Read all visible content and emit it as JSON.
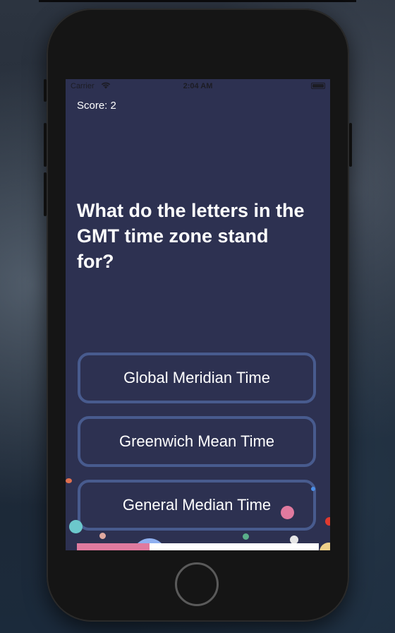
{
  "status_bar": {
    "carrier": "Carrier",
    "time": "2:04 AM"
  },
  "game": {
    "score_label": "Score: 2",
    "question": "What do the letters in the GMT time zone stand for?",
    "answers": [
      "Global Meridian Time",
      "Greenwich Mean Time",
      "General Median Time"
    ],
    "progress_fraction": 0.3
  },
  "colors": {
    "screen_background": "#2d3151",
    "answer_border": "#485b8e",
    "progress_fill": "#e07a9f",
    "progress_track": "#ffffff"
  },
  "icons": {
    "wifi": "wifi-icon",
    "battery": "battery-icon",
    "home": "home-button"
  }
}
